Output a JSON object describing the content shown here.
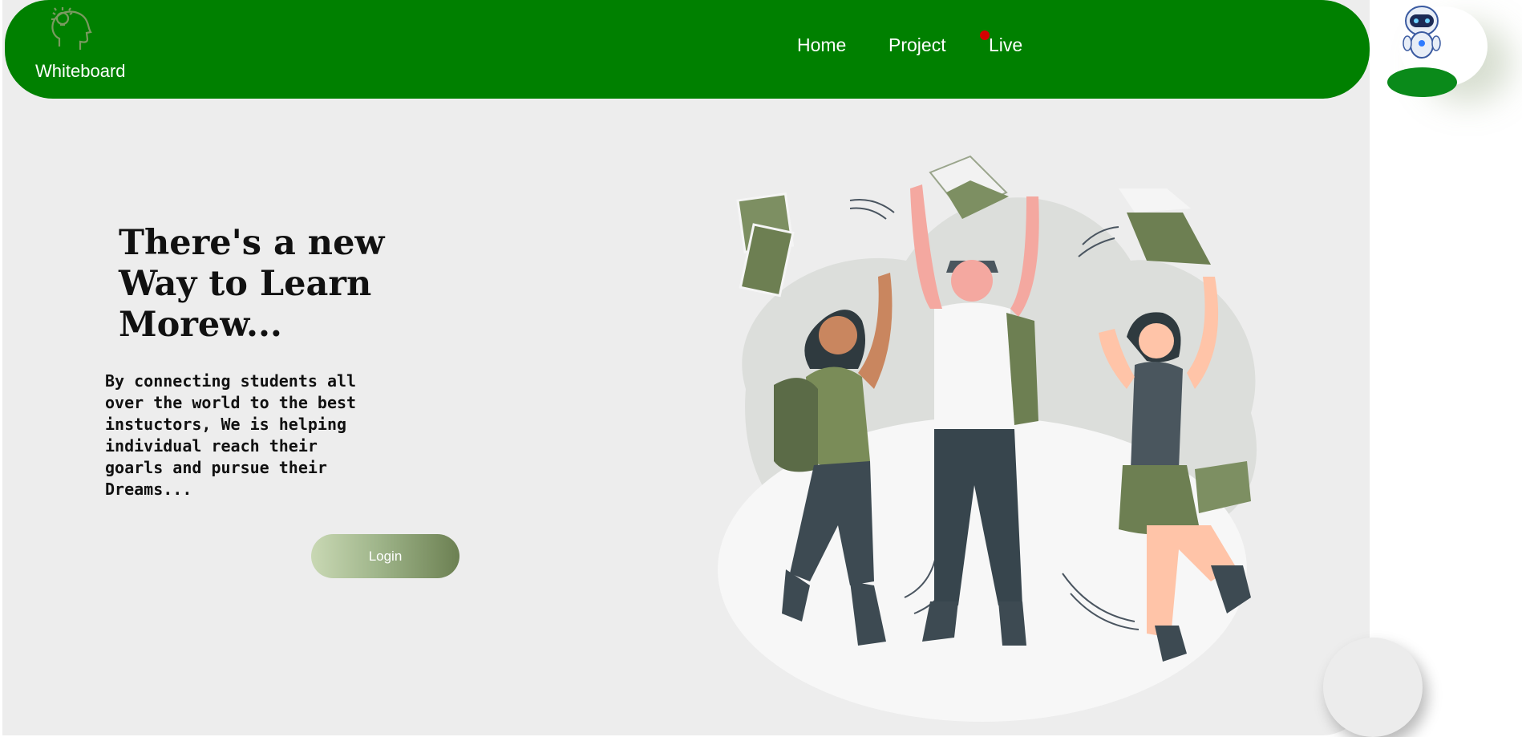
{
  "header": {
    "logo_text": "Whiteboard",
    "nav": {
      "home": "Home",
      "project": "Project",
      "live": "Live"
    },
    "logo_icon": "head-lightbulb-icon",
    "live_indicator_color": "#d40000"
  },
  "hero": {
    "title": "There's a new Way to Learn Morew...",
    "description": "By connecting students all\nover the world to the best\ninstuctors, We is helping\nindividual reach their\ngoarls and pursue their\nDreams...",
    "login_label": "Login"
  },
  "colors": {
    "primary_green": "#008000",
    "page_bg": "#ededed",
    "olive": "#748a56"
  },
  "icons": {
    "assistant": "robot-icon",
    "illustration": "students-jumping-illustration"
  }
}
